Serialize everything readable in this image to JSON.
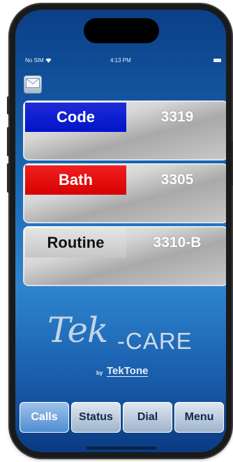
{
  "status_bar": {
    "carrier": "No SIM",
    "wifi_icon": "wifi-icon",
    "time": "4:13 PM",
    "battery_icon": "battery-icon"
  },
  "mail_button": {
    "icon": "envelope-icon"
  },
  "calls": [
    {
      "type": "Code",
      "room": "3319",
      "color": "#0a1ed0"
    },
    {
      "type": "Bath",
      "room": "3305",
      "color": "#e81010"
    },
    {
      "type": "Routine",
      "room": "3310-B",
      "color": "#d2d2d2"
    }
  ],
  "logo": {
    "main": "Tek",
    "dash_care": "-CARE",
    "by": "by",
    "brand": "TekTone"
  },
  "tabs": [
    {
      "label": "Calls",
      "active": true
    },
    {
      "label": "Status",
      "active": false
    },
    {
      "label": "Dial",
      "active": false
    },
    {
      "label": "Menu",
      "active": false
    }
  ]
}
